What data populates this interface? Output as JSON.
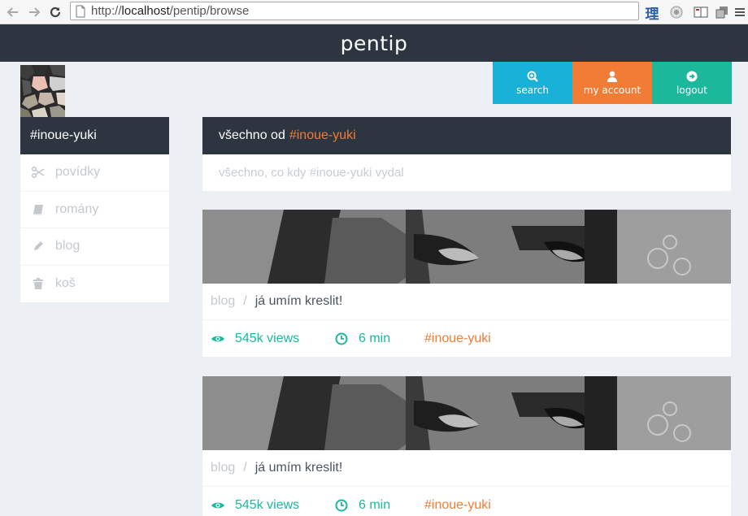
{
  "browser": {
    "url_scheme": "http://",
    "url_host": "localhost",
    "url_path": "/pentip/browse",
    "ext_glyph": "理"
  },
  "header": {
    "brand": "pentip"
  },
  "actions": [
    {
      "label": "search",
      "icon": "search-plus-icon",
      "color": "#1ab1d8"
    },
    {
      "label": "my account",
      "icon": "user-icon",
      "color": "#f07c35"
    },
    {
      "label": "logout",
      "icon": "arrow-circle-icon",
      "color": "#1cb89c"
    }
  ],
  "sidebar": {
    "title": "#inoue-yuki",
    "items": [
      {
        "label": "povídky",
        "icon": "scissors-icon"
      },
      {
        "label": "romány",
        "icon": "book-icon"
      },
      {
        "label": "blog",
        "icon": "pencil-icon"
      },
      {
        "label": "koš",
        "icon": "trash-icon"
      }
    ]
  },
  "main": {
    "title_prefix": "všechno od",
    "title_tag": "#inoue-yuki",
    "subtitle": "všechno, co kdy #inoue-yuki vydal"
  },
  "cards": [
    {
      "category": "blog",
      "separator": "/",
      "title": "já umím kreslit!",
      "views": "545k views",
      "time": "6 min",
      "author": "#inoue-yuki"
    },
    {
      "category": "blog",
      "separator": "/",
      "title": "já umím kreslit!",
      "views": "545k views",
      "time": "6 min",
      "author": "#inoue-yuki"
    }
  ],
  "colors": {
    "dark": "#2d3541",
    "orange": "#f07c35",
    "teal": "#1cb89c",
    "cyan": "#1ab1d8",
    "muted": "#c4c9d0"
  }
}
